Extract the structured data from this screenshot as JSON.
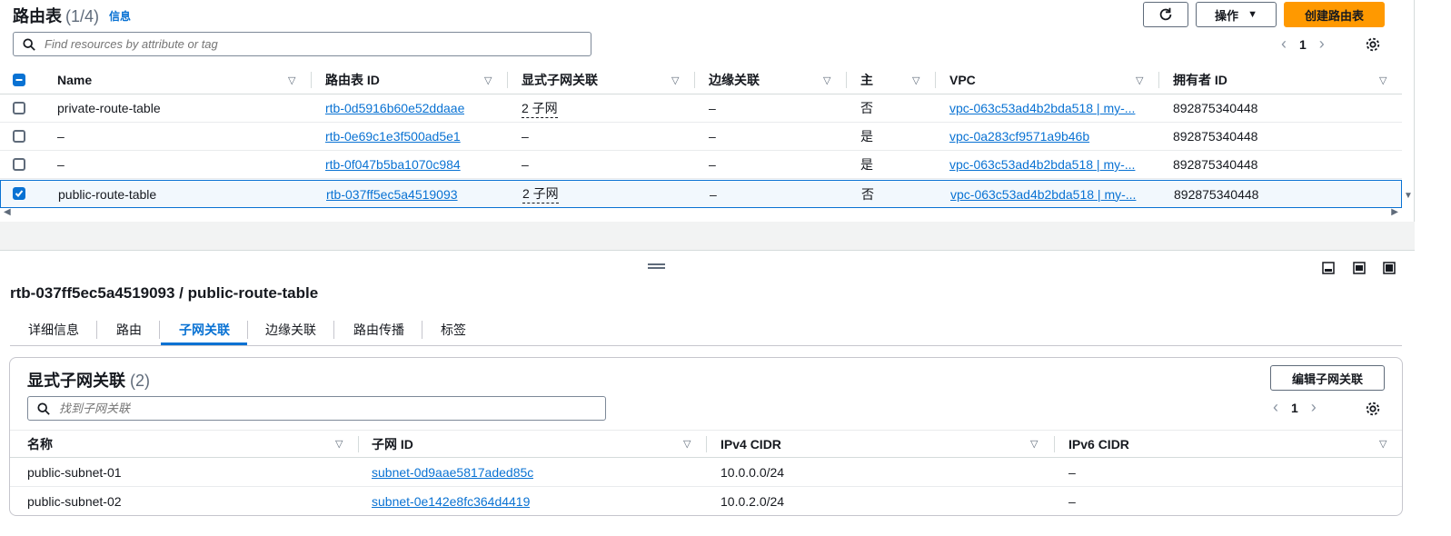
{
  "header": {
    "title": "路由表",
    "count": "(1/4)",
    "info": "信息",
    "actions_label": "操作",
    "create_label": "创建路由表"
  },
  "search": {
    "placeholder": "Find resources by attribute or tag"
  },
  "pagination": {
    "page": "1"
  },
  "route_table": {
    "columns": [
      "Name",
      "路由表 ID",
      "显式子网关联",
      "边缘关联",
      "主",
      "VPC",
      "拥有者 ID"
    ],
    "rows": [
      {
        "checked": false,
        "name": "private-route-table",
        "id": "rtb-0d5916b60e52ddaae",
        "subnets": "2 子网",
        "edge": "–",
        "main": "否",
        "vpc": "vpc-063c53ad4b2bda518 | my-...",
        "owner": "892875340448"
      },
      {
        "checked": false,
        "name": "–",
        "id": "rtb-0e69c1e3f500ad5e1",
        "subnets": "–",
        "edge": "–",
        "main": "是",
        "vpc": "vpc-0a283cf9571a9b46b",
        "owner": "892875340448"
      },
      {
        "checked": false,
        "name": "–",
        "id": "rtb-0f047b5ba1070c984",
        "subnets": "–",
        "edge": "–",
        "main": "是",
        "vpc": "vpc-063c53ad4b2bda518 | my-...",
        "owner": "892875340448"
      },
      {
        "checked": true,
        "name": "public-route-table",
        "id": "rtb-037ff5ec5a4519093",
        "subnets": "2 子网",
        "edge": "–",
        "main": "否",
        "vpc": "vpc-063c53ad4b2bda518 | my-...",
        "owner": "892875340448"
      }
    ]
  },
  "detail": {
    "title": "rtb-037ff5ec5a4519093 / public-route-table",
    "tabs": [
      "详细信息",
      "路由",
      "子网关联",
      "边缘关联",
      "路由传播",
      "标签"
    ],
    "active_tab": "子网关联"
  },
  "subnet_assoc": {
    "title": "显式子网关联",
    "count": "(2)",
    "edit_label": "编辑子网关联",
    "search_placeholder": "找到子网关联",
    "page": "1",
    "columns": [
      "名称",
      "子网 ID",
      "IPv4 CIDR",
      "IPv6 CIDR"
    ],
    "rows": [
      {
        "name": "public-subnet-01",
        "subnet_id": "subnet-0d9aae5817aded85c",
        "ipv4": "10.0.0.0/24",
        "ipv6": "–"
      },
      {
        "name": "public-subnet-02",
        "subnet_id": "subnet-0e142e8fc364d4419",
        "ipv4": "10.0.2.0/24",
        "ipv6": "–"
      }
    ]
  },
  "colors": {
    "accent": "#0972d3",
    "primary_button": "#ff9900",
    "text": "#16191f"
  }
}
